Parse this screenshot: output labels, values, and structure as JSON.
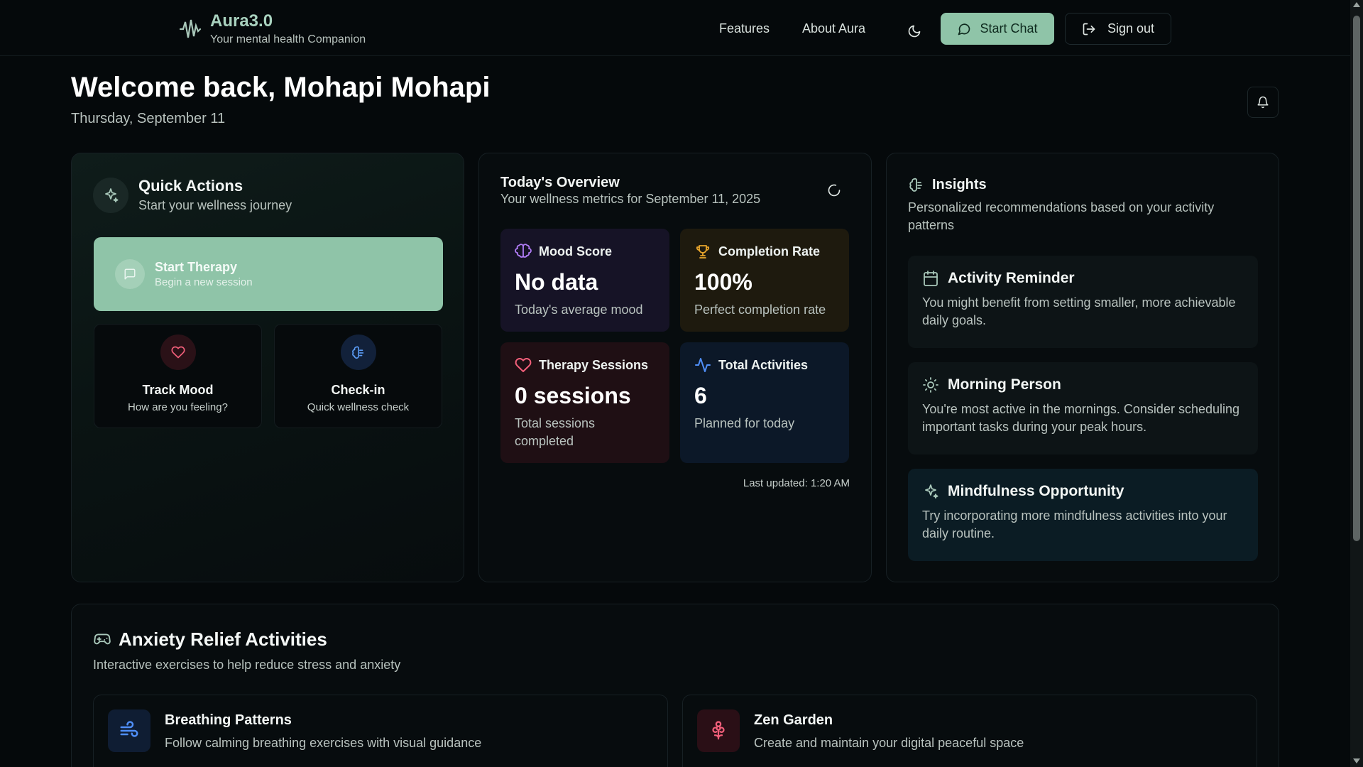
{
  "brand": {
    "name": "Aura3.0",
    "tagline": "Your mental health Companion",
    "icon": "waveform-icon"
  },
  "nav": {
    "features": "Features",
    "about": "About Aura",
    "theme_icon": "moon-icon",
    "start_chat": "Start Chat",
    "sign_out": "Sign out"
  },
  "welcome": {
    "title": "Welcome back, Mohapi Mohapi",
    "date": "Thursday, September 11"
  },
  "quick_actions": {
    "title": "Quick Actions",
    "subtitle": "Start your wellness journey",
    "primary": {
      "title": "Start Therapy",
      "subtitle": "Begin a new session"
    },
    "items": [
      {
        "title": "Track Mood",
        "subtitle": "How are you feeling?",
        "icon": "heart-icon",
        "color": "#f25f7a"
      },
      {
        "title": "Check-in",
        "subtitle": "Quick wellness check",
        "icon": "brain-icon",
        "color": "#5b9cf5"
      }
    ]
  },
  "overview": {
    "title": "Today's Overview",
    "subtitle": "Your wellness metrics for September 11, 2025",
    "metrics": [
      {
        "label": "Mood Score",
        "value": "No data",
        "desc": "Today's average mood",
        "icon": "brain-icon",
        "color": "#b07cf5",
        "bg": "#161326"
      },
      {
        "label": "Completion Rate",
        "value": "100%",
        "desc": "Perfect completion rate",
        "icon": "trophy-icon",
        "color": "#e8a52c",
        "bg": "#1e1a0e"
      },
      {
        "label": "Therapy Sessions",
        "value": "0 sessions",
        "desc": "Total sessions completed",
        "icon": "heart-icon",
        "color": "#f25f7a",
        "bg": "#1f0f14"
      },
      {
        "label": "Total Activities",
        "value": "6",
        "desc": "Planned for today",
        "icon": "activity-icon",
        "color": "#4f8ef7",
        "bg": "#0c1828"
      }
    ],
    "last_updated": "Last updated: 1:20 AM"
  },
  "insights": {
    "title": "Insights",
    "subtitle": "Personalized recommendations based on your activity patterns",
    "items": [
      {
        "title": "Activity Reminder",
        "text": "You might benefit from setting smaller, more achievable daily goals.",
        "icon": "calendar-icon",
        "bg": "#0d1416"
      },
      {
        "title": "Morning Person",
        "text": "You're most active in the mornings. Consider scheduling important tasks during your peak hours.",
        "icon": "sun-icon",
        "bg": "#0d1416"
      },
      {
        "title": "Mindfulness Opportunity",
        "text": "Try incorporating more mindfulness activities into your daily routine.",
        "icon": "sparkles-icon",
        "bg": "#0b1c24"
      }
    ]
  },
  "anxiety": {
    "title": "Anxiety Relief Activities",
    "subtitle": "Interactive exercises to help reduce stress and anxiety",
    "activities": [
      {
        "title": "Breathing Patterns",
        "subtitle": "Follow calming breathing exercises with visual guidance",
        "icon": "wind-icon",
        "color": "#4f8ef7",
        "bg": "#0f1d33"
      },
      {
        "title": "Zen Garden",
        "subtitle": "Create and maintain your digital peaceful space",
        "icon": "flower-icon",
        "color": "#f25f7a",
        "bg": "#2a0f16"
      }
    ]
  }
}
